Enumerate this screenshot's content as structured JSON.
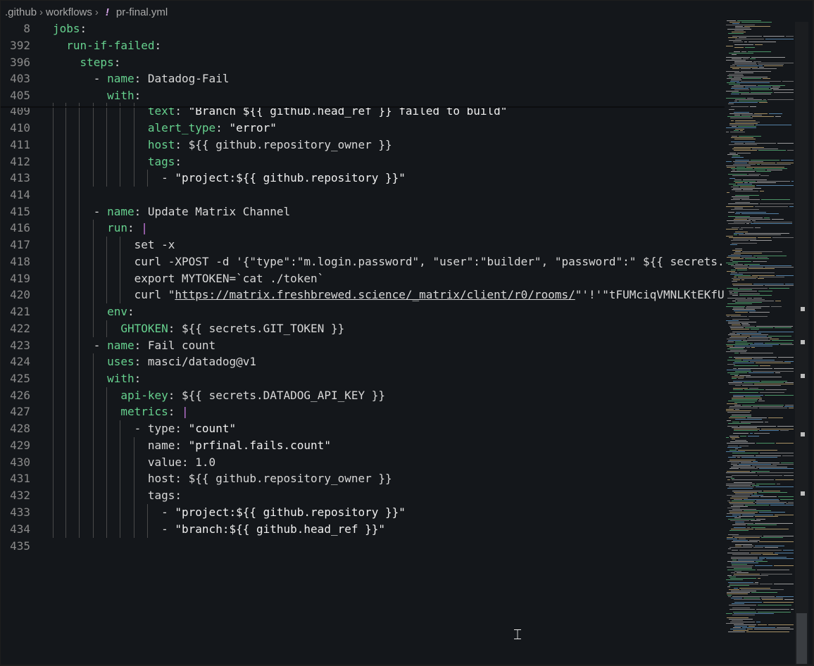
{
  "breadcrumb": {
    "folder1": ".github",
    "folder2": "workflows",
    "file_icon": "!",
    "file": "pr-final.yml"
  },
  "code_lines": [
    {
      "n": "8",
      "html": "<span class='k'>jobs</span><span class='d'>:</span>"
    },
    {
      "n": "392",
      "html": "  <span class='k'>run-if-failed</span><span class='d'>:</span>"
    },
    {
      "n": "396",
      "html": "    <span class='k'>steps</span><span class='d'>:</span>"
    },
    {
      "n": "403",
      "html": "      <span class='d'>- </span><span class='k'>name</span><span class='d'>: Datadog-Fail</span>"
    },
    {
      "n": "405",
      "html": "        <span class='k'>with</span><span class='d'>:</span>"
    },
    {
      "n": "409",
      "html": "              <span class='k'>text</span><span class='d'>: </span><span class='s'>\"Branch ${{ github.head_ref }} failed to build\"</span>"
    },
    {
      "n": "410",
      "html": "              <span class='k'>alert_type</span><span class='d'>: </span><span class='s'>\"error\"</span>"
    },
    {
      "n": "411",
      "html": "              <span class='k'>host</span><span class='d'>: ${{ github.repository_owner }}</span>"
    },
    {
      "n": "412",
      "html": "              <span class='k'>tags</span><span class='d'>:</span>"
    },
    {
      "n": "413",
      "html": "                <span class='d'>- </span><span class='s'>\"project:${{ github.repository }}\"</span>"
    },
    {
      "n": "414",
      "html": ""
    },
    {
      "n": "415",
      "html": "      <span class='d'>- </span><span class='k'>name</span><span class='d'>: Update Matrix Channel</span>"
    },
    {
      "n": "416",
      "html": "        <span class='k'>run</span><span class='d'>: </span><span class='p'>|</span>"
    },
    {
      "n": "417",
      "html": "            <span class='d'>set -x</span>"
    },
    {
      "n": "418",
      "html": "            <span class='d'>curl -XPOST -d '{\"type\":\"m.login.password\", \"user\":\"builder\", \"password\":\" ${{ secrets.MATRIX_BUILD</span>"
    },
    {
      "n": "419",
      "html": "            <span class='d'>export MYTOKEN=`cat ./token`</span>"
    },
    {
      "n": "420",
      "html": "            <span class='d'>curl \"</span><span class='d u'>https://matrix.freshbrewed.science/_matrix/client/r0/rooms/</span><span class='d'>\"'!'\"tFUMciqVMNLKtEKfUbp:matrix</span>"
    },
    {
      "n": "421",
      "html": "        <span class='k'>env</span><span class='d'>:</span>"
    },
    {
      "n": "422",
      "html": "          <span class='k'>GHTOKEN</span><span class='d'>: ${{ secrets.GIT_TOKEN }}</span>"
    },
    {
      "n": "423",
      "html": "      <span class='d'>- </span><span class='k'>name</span><span class='d'>: Fail count</span>"
    },
    {
      "n": "424",
      "html": "        <span class='k'>uses</span><span class='d'>: masci/datadog@v1</span>"
    },
    {
      "n": "425",
      "html": "        <span class='k'>with</span><span class='d'>:</span>"
    },
    {
      "n": "426",
      "html": "          <span class='k'>api-key</span><span class='d'>: ${{ secrets.DATADOG_API_KEY }}</span>"
    },
    {
      "n": "427",
      "html": "          <span class='k'>metrics</span><span class='d'>: </span><span class='p'>|</span>"
    },
    {
      "n": "428",
      "html": "            <span class='d'>- type: </span><span class='s'>\"count\"</span>"
    },
    {
      "n": "429",
      "html": "              <span class='d'>name: </span><span class='s'>\"prfinal.fails.count\"</span>"
    },
    {
      "n": "430",
      "html": "              <span class='d'>value: 1.0</span>"
    },
    {
      "n": "431",
      "html": "              <span class='d'>host: ${{ github.repository_owner }}</span>"
    },
    {
      "n": "432",
      "html": "              <span class='d'>tags:</span>"
    },
    {
      "n": "433",
      "html": "                <span class='d'>- </span><span class='s'>\"project:${{ github.repository }}\"</span>"
    },
    {
      "n": "434",
      "html": "                <span class='d'>- </span><span class='s'>\"branch:${{ github.head_ref }}\"</span>"
    },
    {
      "n": "435",
      "html": ""
    }
  ],
  "colors": {
    "background": "#14171b",
    "key": "#66d18e",
    "text": "#d8d8d8",
    "block_indicator": "#c678dd",
    "line_number": "#8b8b8b"
  },
  "icons": {
    "file_type": "yaml-exclamation-icon",
    "cursor": "text-cursor-icon"
  }
}
